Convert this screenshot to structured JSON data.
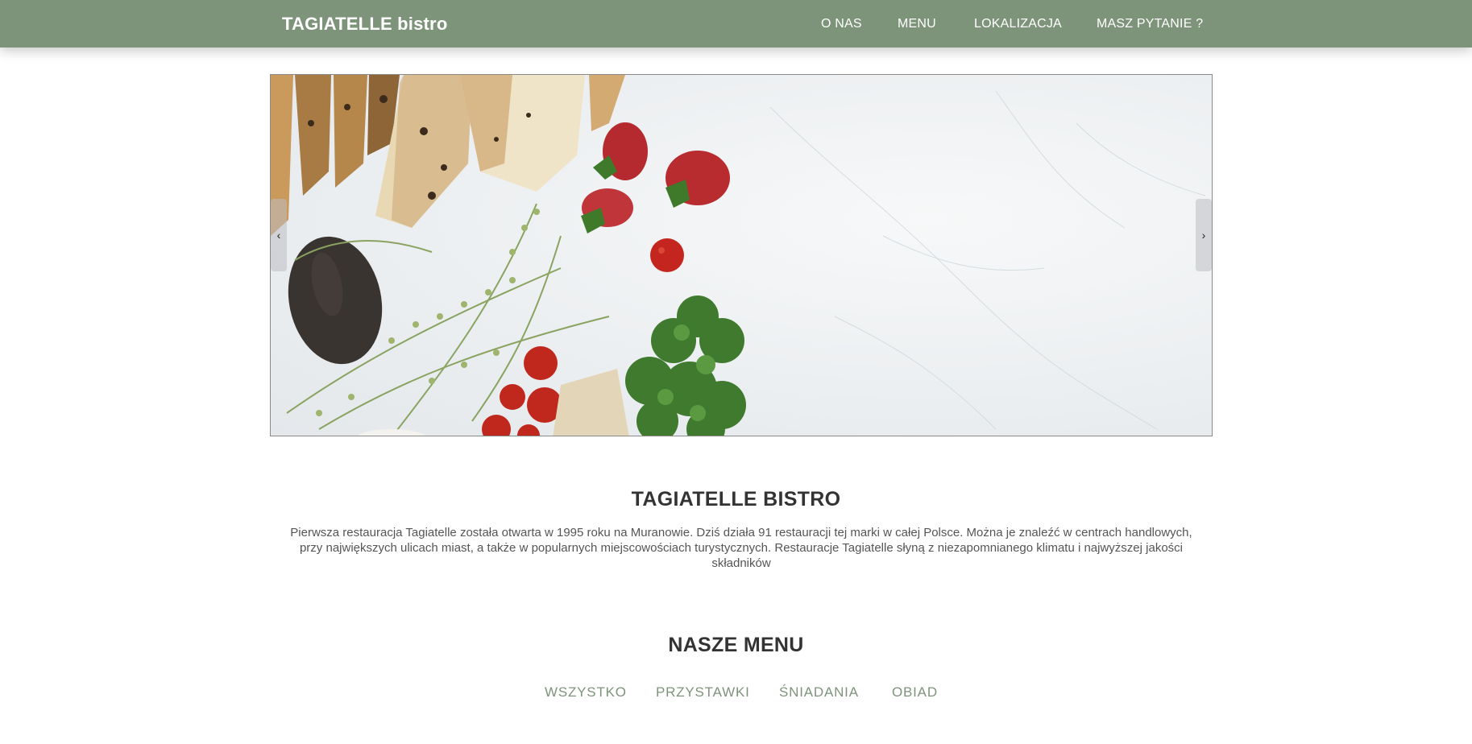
{
  "header": {
    "brand": "TAGIATELLE bistro",
    "nav": [
      "O NAS",
      "MENU",
      "LOKALIZACJA",
      "MASZ PYTANIE ?"
    ]
  },
  "carousel": {
    "prev_label": "‹",
    "next_label": "›"
  },
  "about": {
    "title": "TAGIATELLE BISTRO",
    "text": "Pierwsza restauracja Tagiatelle została otwarta w 1995 roku na Muranowie. Dziś działa 91 restauracji tej marki w całej Polsce. Można je znaleźć w centrach handlowych, przy największych ulicach miast, a także w popularnych miejscowościach turystycznych. Restauracje Tagiatelle słyną z niezapomnianego klimatu i najwyższej jakości składników"
  },
  "menu": {
    "title": "NASZE MENU",
    "filters": [
      "WSZYSTKO",
      "PRZYSTAWKI",
      "ŚNIADANIA",
      "OBIAD"
    ]
  },
  "colors": {
    "accent": "#7e947a",
    "text": "#333333"
  }
}
